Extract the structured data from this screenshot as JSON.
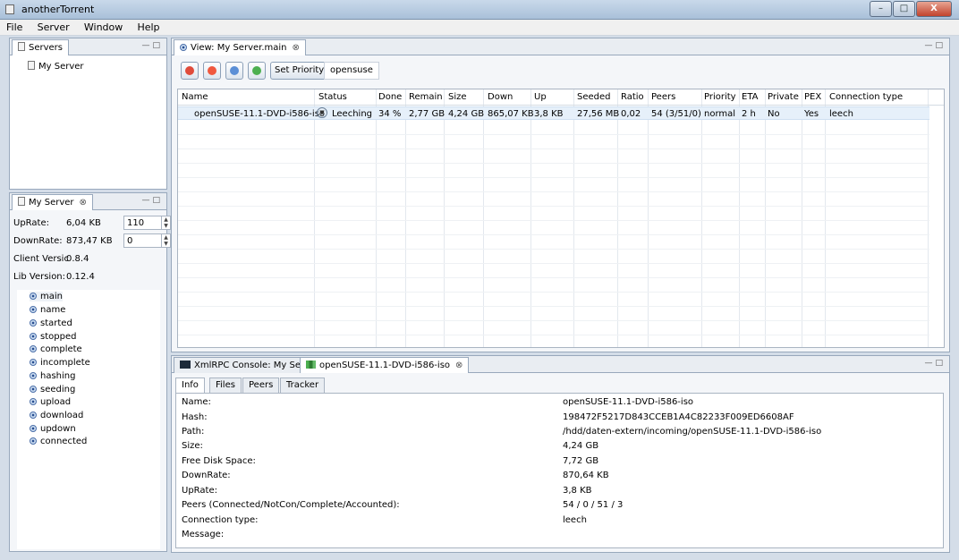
{
  "app": {
    "title": "anotherTorrent"
  },
  "window_controls": {
    "minimize": "–",
    "maximize": "□",
    "close": "X"
  },
  "menu": [
    "File",
    "Server",
    "Window",
    "Help"
  ],
  "servers_panel": {
    "tab": "Servers",
    "items": [
      "My Server"
    ]
  },
  "myserver_panel": {
    "tab": "My Server",
    "uprate_label": "UpRate:",
    "uprate_value": "6,04 KB",
    "uprate_limit": "110",
    "downrate_label": "DownRate:",
    "downrate_value": "873,47 KB",
    "downrate_limit": "0",
    "client_label": "Client Versic",
    "client_value": "0.8.4",
    "lib_label": "Lib Version:",
    "lib_value": "0.12.4",
    "views": [
      "main",
      "name",
      "started",
      "stopped",
      "complete",
      "incomplete",
      "hashing",
      "seeding",
      "upload",
      "download",
      "updown",
      "connected"
    ]
  },
  "view_panel": {
    "tab": "View: My Server.main",
    "set_priority": "Set Priority",
    "filter": "opensuse",
    "columns": [
      "Name",
      "Status",
      "Done",
      "Remain",
      "Size",
      "Down",
      "Up",
      "Seeded",
      "Ratio",
      "Peers",
      "Priority",
      "ETA",
      "Private",
      "PEX",
      "Connection type"
    ],
    "rows": [
      [
        "openSUSE-11.1-DVD-i586-iso",
        "Leeching",
        "34 %",
        "2,77 GB",
        "4,24 GB",
        "865,07 KB",
        "3,8 KB",
        "27,56 MB",
        "0,02",
        "54 (3/51/0)",
        "normal",
        "2 h",
        "No",
        "Yes",
        "leech"
      ]
    ]
  },
  "bottom_panel": {
    "tab_console": "XmlRPC Console: My Server",
    "tab_torrent": "openSUSE-11.1-DVD-i586-iso",
    "info_tabs": [
      "Info",
      "Files",
      "Peers",
      "Tracker"
    ],
    "info": [
      {
        "label": "Name:",
        "value": "openSUSE-11.1-DVD-i586-iso"
      },
      {
        "label": "Hash:",
        "value": "198472F5217D843CCEB1A4C82233F009ED6608AF"
      },
      {
        "label": "Path:",
        "value": "/hdd/daten-extern/incoming/openSUSE-11.1-DVD-i586-iso"
      },
      {
        "label": "Size:",
        "value": "4,24 GB"
      },
      {
        "label": "Free Disk Space:",
        "value": "7,72 GB"
      },
      {
        "label": "DownRate:",
        "value": "870,64 KB"
      },
      {
        "label": "UpRate:",
        "value": "3,8 KB"
      },
      {
        "label": "Peers (Connected/NotCon/Complete/Accounted):",
        "value": "54 / 0 / 51 / 3"
      },
      {
        "label": "Connection type:",
        "value": "leech"
      },
      {
        "label": "Message:",
        "value": ""
      }
    ]
  }
}
